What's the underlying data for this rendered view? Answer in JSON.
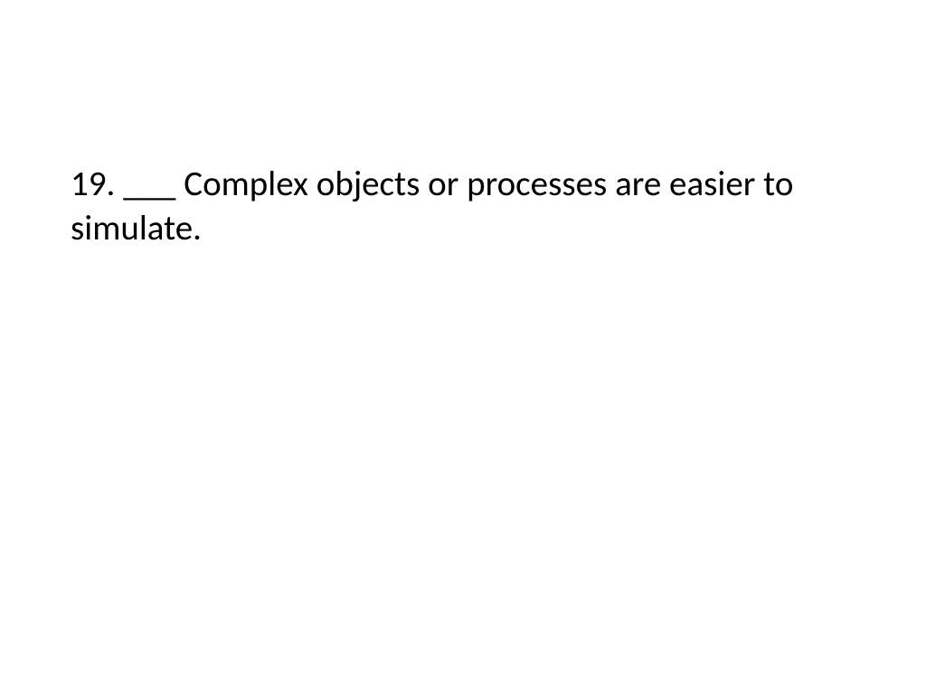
{
  "slide": {
    "question_number": "19.",
    "blank": "___",
    "statement": "Complex objects or processes are easier to simulate.",
    "full_text": "19.  ___  Complex objects or processes are easier to simulate."
  }
}
